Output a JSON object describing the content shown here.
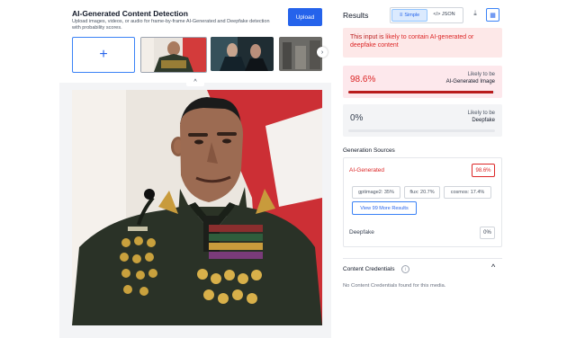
{
  "header": {
    "title": "AI-Generated Content Detection",
    "subtitle": "Upload images, videos, or audio for frame-by-frame AI-Generated and Deepfake detection with probability scores.",
    "upload_label": "Upload"
  },
  "thumbnails": {
    "add_symbol": "+",
    "next_symbol": "›",
    "collapse_symbol": "^"
  },
  "results": {
    "title": "Results",
    "toggle_simple": "Simple",
    "toggle_json": "</> JSON",
    "alert_prefix": "This input is ",
    "alert_highlight": "likely to contain AI-generated or deepfake content",
    "ai_card": {
      "percent": "98.6%",
      "likely": "Likely to be",
      "label": "AI-Generated Image",
      "fill": 0.986
    },
    "deepfake_card": {
      "percent": "0%",
      "likely": "Likely to be",
      "label": "Deepfake",
      "fill": 0
    }
  },
  "sources": {
    "title": "Generation Sources",
    "ai_label": "AI-Generated",
    "ai_percent": "98.6%",
    "chips": [
      "gptimage2: 35%",
      "flux: 20.7%",
      "cosmos: 17.4%"
    ],
    "more_label": "View 99 More Results",
    "deepfake_label": "Deepfake",
    "deepfake_percent": "0%"
  },
  "credentials": {
    "title": "Content Credentials",
    "info_symbol": "i",
    "chevron": "^",
    "empty_text": "No Content Credentials found for this media."
  },
  "colors": {
    "accent": "#2563eb",
    "danger": "#dc2626"
  }
}
